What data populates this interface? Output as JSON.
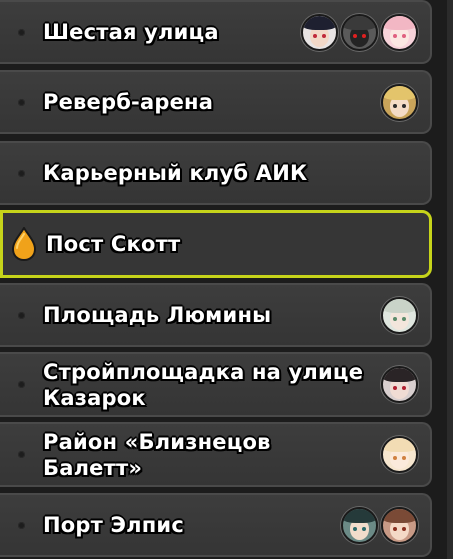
{
  "locations": [
    {
      "label": "Шестая улица",
      "selected": false,
      "avatars": [
        {
          "icon": "character-avatar-dark-hair-red-eyes",
          "hair": "#1e2030",
          "skin": "#f2d8c8",
          "bg": "#e8e4e4",
          "eye": "#c0283a"
        },
        {
          "icon": "character-avatar-helmet-red-visor",
          "hair": "#3a3a3a",
          "skin": "#242424",
          "bg": "#5a5a5a",
          "eye": "#e02020"
        },
        {
          "icon": "character-avatar-pink-hair",
          "hair": "#f2b7c4",
          "skin": "#fbe7e2",
          "bg": "#f7d3da",
          "eye": "#e06080"
        }
      ]
    },
    {
      "label": "Реверб-арена",
      "selected": false,
      "avatars": [
        {
          "icon": "character-avatar-blonde-glasses",
          "hair": "#e3c46b",
          "skin": "#f4dcc6",
          "bg": "#c9a45a",
          "eye": "#2a2a2a"
        }
      ]
    },
    {
      "label": "Карьерный клуб АИК",
      "selected": false,
      "avatars": []
    },
    {
      "label": "Пост Скотт",
      "selected": true,
      "avatars": []
    },
    {
      "label": "Площадь Люмины",
      "selected": false,
      "avatars": [
        {
          "icon": "character-avatar-silver-hair",
          "hair": "#c9d3c8",
          "skin": "#f3e6dc",
          "bg": "#dfe6df",
          "eye": "#5a8a6a"
        }
      ]
    },
    {
      "label": "Стройплощадка на улице Казарок",
      "selected": false,
      "avatars": [
        {
          "icon": "character-avatar-dark-hair-mask",
          "hair": "#2a2426",
          "skin": "#f0dcd4",
          "bg": "#d8cfcf",
          "eye": "#b02030"
        }
      ]
    },
    {
      "label": "Район «Близнецов Балетт»",
      "selected": false,
      "avatars": [
        {
          "icon": "character-avatar-light-blonde-hair",
          "hair": "#f2dcb4",
          "skin": "#fbeadb",
          "bg": "#f6e6cf",
          "eye": "#d08040"
        }
      ]
    },
    {
      "label": "Порт Элпис",
      "selected": false,
      "avatars": [
        {
          "icon": "character-avatar-teal-dark-hair",
          "hair": "#253a3a",
          "skin": "#f1dccb",
          "bg": "#6b8a86",
          "eye": "#2a6a6a"
        },
        {
          "icon": "character-avatar-brown-hair",
          "hair": "#7a4a36",
          "skin": "#f4d9c6",
          "bg": "#c89a86",
          "eye": "#8a3020"
        }
      ]
    }
  ],
  "colors": {
    "selected_border": "#c6d41a",
    "pin_orange": "#f0a21a",
    "item_bg": "#3a3a3a"
  }
}
